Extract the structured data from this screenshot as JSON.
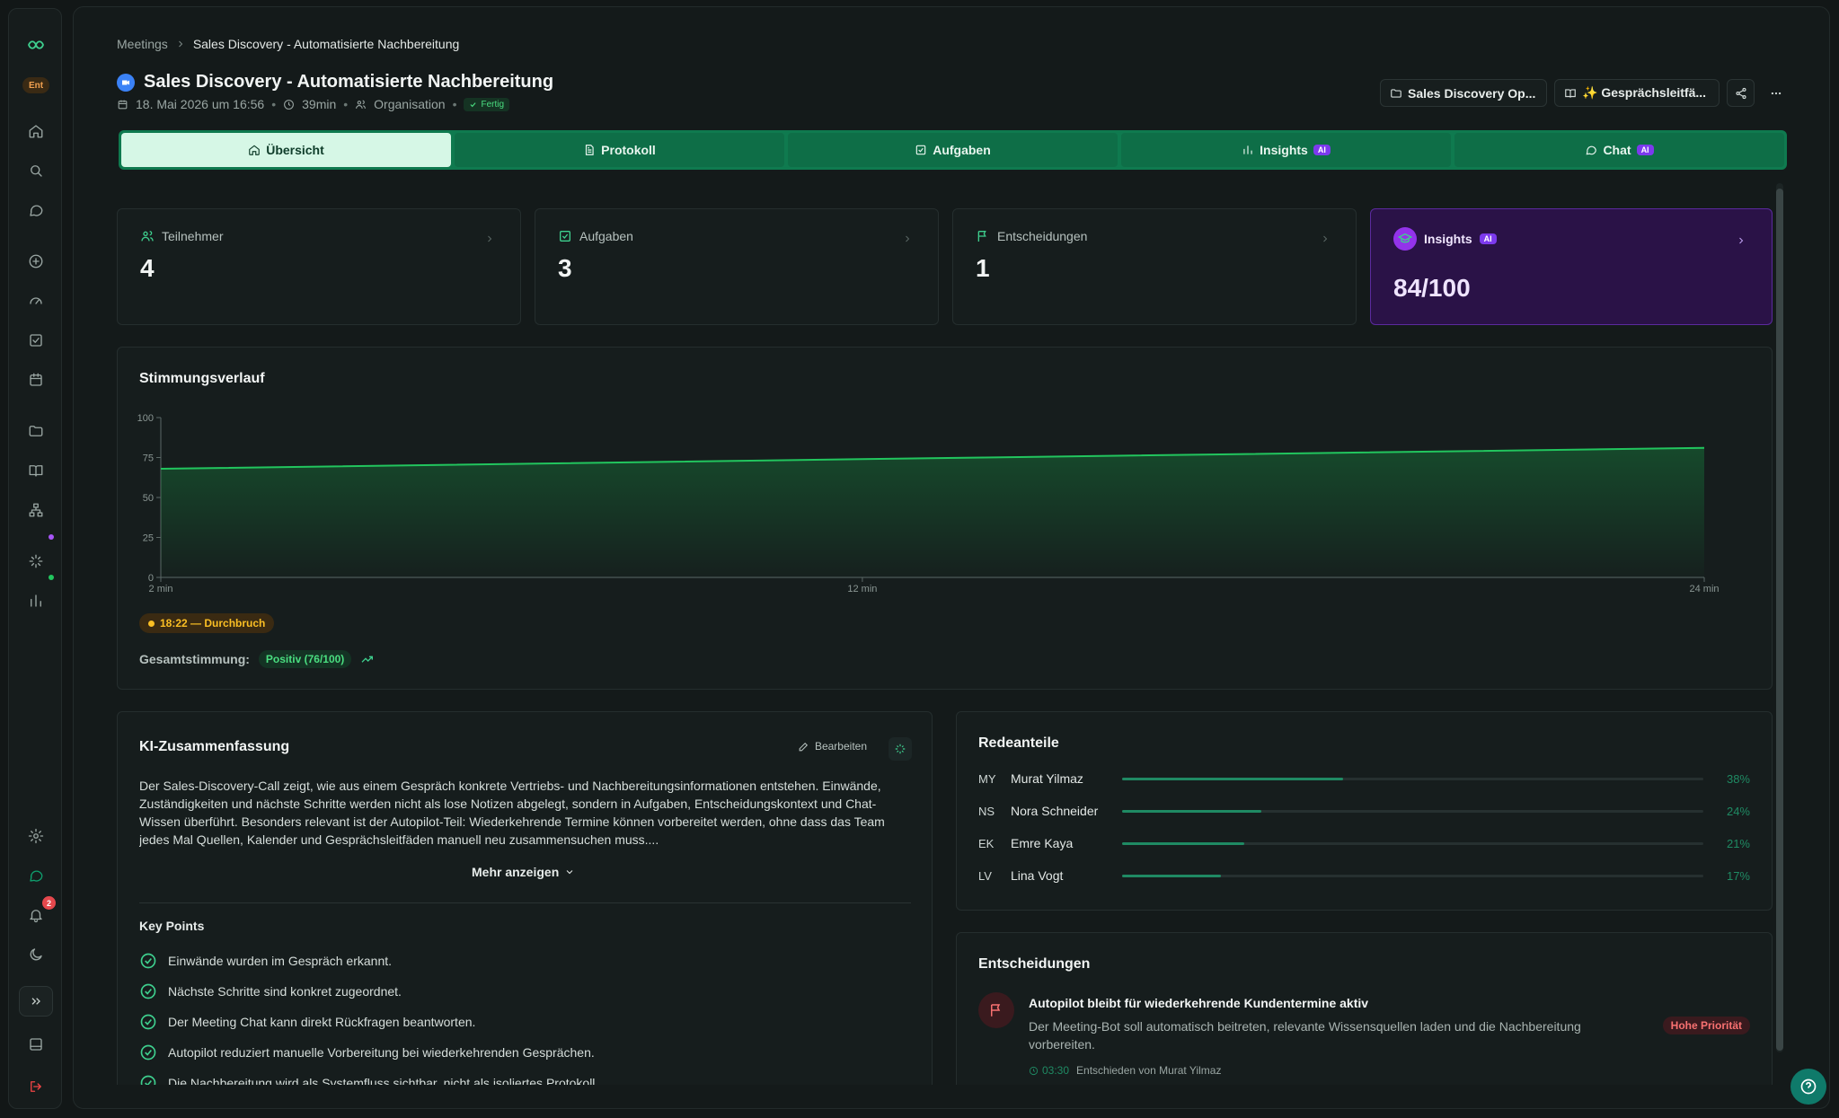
{
  "sidebar": {
    "badge": "Ent",
    "notifications_count": "2"
  },
  "breadcrumb": {
    "root": "Meetings",
    "current": "Sales Discovery - Automatisierte Nachbereitung"
  },
  "header": {
    "title": "Sales Discovery - Automatisierte Nachbereitung",
    "date": "18. Mai 2026 um 16:56",
    "duration": "39min",
    "scope": "Organisation",
    "status": "Fertig",
    "folder_button": "Sales Discovery Op...",
    "guide_button": "✨ Gesprächsleitfä..."
  },
  "tabs": [
    {
      "label": "Übersicht",
      "icon": "home-icon",
      "ai": ""
    },
    {
      "label": "Protokoll",
      "icon": "document-icon",
      "ai": ""
    },
    {
      "label": "Aufgaben",
      "icon": "checkbox-icon",
      "ai": ""
    },
    {
      "label": "Insights",
      "icon": "bar-chart-icon",
      "ai": "AI"
    },
    {
      "label": "Chat",
      "icon": "chat-icon",
      "ai": "AI"
    }
  ],
  "stats": [
    {
      "label": "Teilnehmer",
      "value": "4",
      "icon": "users-icon"
    },
    {
      "label": "Aufgaben",
      "value": "3",
      "icon": "checkbox-icon"
    },
    {
      "label": "Entscheidungen",
      "value": "1",
      "icon": "flag-icon"
    }
  ],
  "insights_card": {
    "label": "Insights",
    "badge": "AI",
    "value": "84/100"
  },
  "sentiment": {
    "title": "Stimmungsverlauf",
    "moment": "18:22 — Durchbruch",
    "overall_label": "Gesamtstimmung:",
    "overall_value": "Positiv (76/100)"
  },
  "chart_data": {
    "type": "area",
    "x": [
      "2 min",
      "12 min",
      "24 min"
    ],
    "xlabels": [
      "2 min",
      "12 min",
      "24 min"
    ],
    "x_values": [
      2,
      12,
      24
    ],
    "y_values": [
      68,
      74,
      81
    ],
    "yticks": [
      "100",
      "75",
      "50",
      "25",
      "0"
    ],
    "ylim": [
      0,
      100
    ],
    "xlim": [
      2,
      24
    ],
    "color": "#22c55e",
    "grid": false
  },
  "summary": {
    "title": "KI-Zusammenfassung",
    "edit_label": "Bearbeiten",
    "text": "Der Sales-Discovery-Call zeigt, wie aus einem Gespräch konkrete Vertriebs- und Nachbereitungsinformationen entstehen. Einwände, Zuständigkeiten und nächste Schritte werden nicht als lose Notizen abgelegt, sondern in Aufgaben, Entscheidungskontext und Chat-Wissen überführt. Besonders relevant ist der Autopilot-Teil: Wiederkehrende Termine können vorbereitet werden, ohne dass das Team jedes Mal Quellen, Kalender und Gesprächsleitfäden manuell neu zusammensuchen muss....",
    "more_label": "Mehr anzeigen",
    "key_points_title": "Key Points",
    "key_points": [
      "Einwände wurden im Gespräch erkannt.",
      "Nächste Schritte sind konkret zugeordnet.",
      "Der Meeting Chat kann direkt Rückfragen beantworten.",
      "Autopilot reduziert manuelle Vorbereitung bei wiederkehrenden Gesprächen.",
      "Die Nachbereitung wird als Systemfluss sichtbar, nicht als isoliertes Protokoll."
    ]
  },
  "speakers": {
    "title": "Redeanteile",
    "items": [
      {
        "initials": "MY",
        "name": "Murat Yilmaz",
        "percent": "38%",
        "share": 38
      },
      {
        "initials": "NS",
        "name": "Nora Schneider",
        "percent": "24%",
        "share": 24
      },
      {
        "initials": "EK",
        "name": "Emre Kaya",
        "percent": "21%",
        "share": 21
      },
      {
        "initials": "LV",
        "name": "Lina Vogt",
        "percent": "17%",
        "share": 17
      }
    ]
  },
  "decisions": {
    "title": "Entscheidungen",
    "items": [
      {
        "title": "Autopilot bleibt für wiederkehrende Kundentermine aktiv",
        "description": "Der Meeting-Bot soll automatisch beitreten, relevante Wissensquellen laden und die Nachbereitung vorbereiten.",
        "priority": "Hohe Priorität",
        "time": "03:30",
        "decided_by": "Entschieden von Murat Yilmaz"
      }
    ]
  },
  "colors": {
    "accent": "#3ecf8e",
    "tab_bar": "#0f7a4f",
    "insights": "#2a1247",
    "priority": "#f87171"
  }
}
